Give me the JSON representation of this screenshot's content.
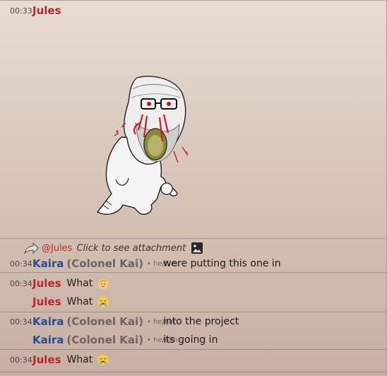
{
  "colors": {
    "jules": "#b8272d",
    "kaira": "#2b4a8f",
    "background": "#d7c6b9"
  },
  "first_message": {
    "time": "00:33",
    "author": "Jules",
    "attachment": "wojak-screaming-sticker"
  },
  "reply_preview": {
    "mention": "@Jules",
    "text": "Click to see attachment",
    "icon": "image-icon"
  },
  "messages": [
    {
      "time": "00:34",
      "author": "Kaira",
      "nickname": "(Colonel Kai)",
      "pronouns": "• he/him",
      "text": "were putting this one in"
    },
    {
      "time": "00:34",
      "author": "Jules",
      "text": "What",
      "emoji": "baby-face-emoji"
    },
    {
      "time": "",
      "author": "Jules",
      "text": "What",
      "emoji": "crying-face-emoji"
    },
    {
      "time": "00:34",
      "author": "Kaira",
      "nickname": "(Colonel Kai)",
      "pronouns": "• he/him",
      "text": "into the project"
    },
    {
      "time": "",
      "author": "Kaira",
      "nickname": "(Colonel Kai)",
      "pronouns": "• he/him",
      "text": "its going in"
    },
    {
      "time": "00:34",
      "author": "Jules",
      "text": "What",
      "emoji": "crying-face-emoji"
    }
  ]
}
